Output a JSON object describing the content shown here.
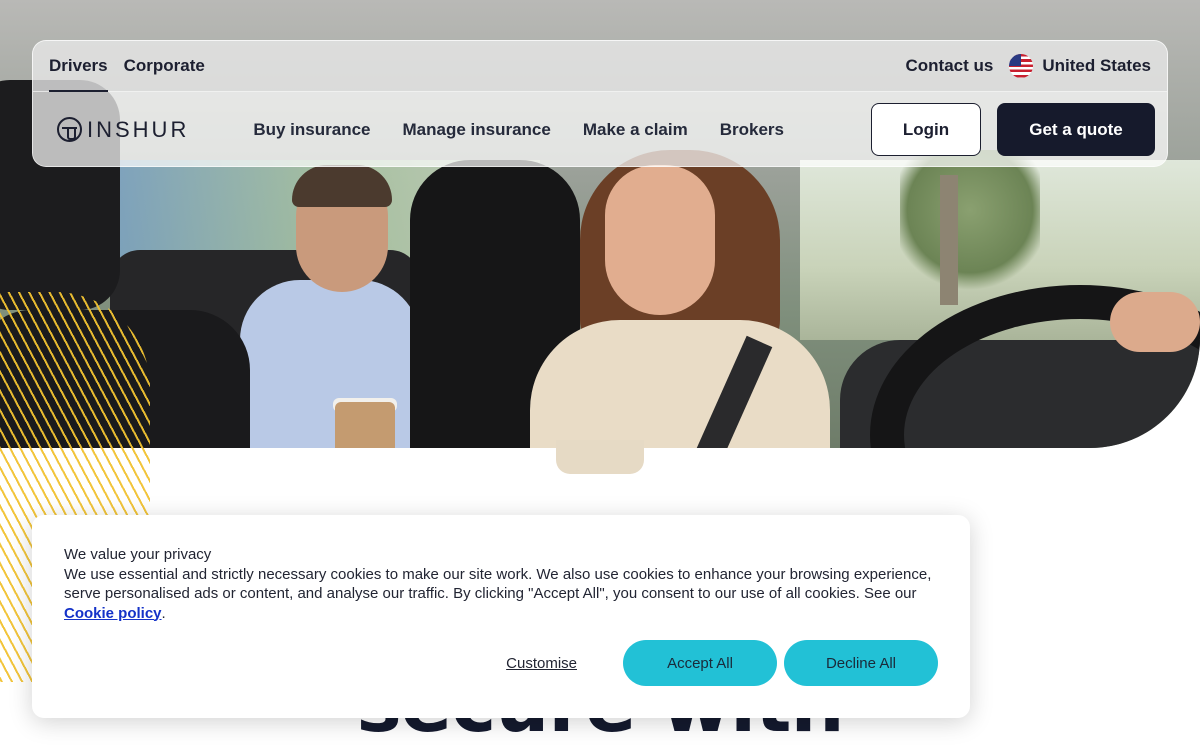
{
  "nav": {
    "segments": [
      {
        "label": "Drivers",
        "active": true
      },
      {
        "label": "Corporate",
        "active": false
      }
    ],
    "contact_label": "Contact us",
    "country_label": "United States",
    "logo_text": "INSHUR",
    "menu": [
      "Buy insurance",
      "Manage insurance",
      "Make a claim",
      "Brokers"
    ],
    "login_label": "Login",
    "quote_label": "Get a quote"
  },
  "hero": {
    "headline_partial": "secure with"
  },
  "cookie_banner": {
    "title": "We value your privacy",
    "body": "We use essential and strictly necessary cookies to make our site work. We also use cookies to enhance your browsing experience, serve personalised ads or content, and analyse our traffic. By clicking \"Accept All\", you consent to our use of all cookies. See our ",
    "policy_link": "Cookie policy",
    "trailing": ".",
    "customise_label": "Customise",
    "accept_label": "Accept All",
    "decline_label": "Decline All"
  },
  "colors": {
    "accent_cyan": "#22c1d6",
    "primary_dark": "#161a2c",
    "link_blue": "#1432c8",
    "stripe_yellow": "#f1c232"
  },
  "icons": {
    "flag": "us-flag-icon",
    "logo": "steering-wheel-logo-icon"
  }
}
